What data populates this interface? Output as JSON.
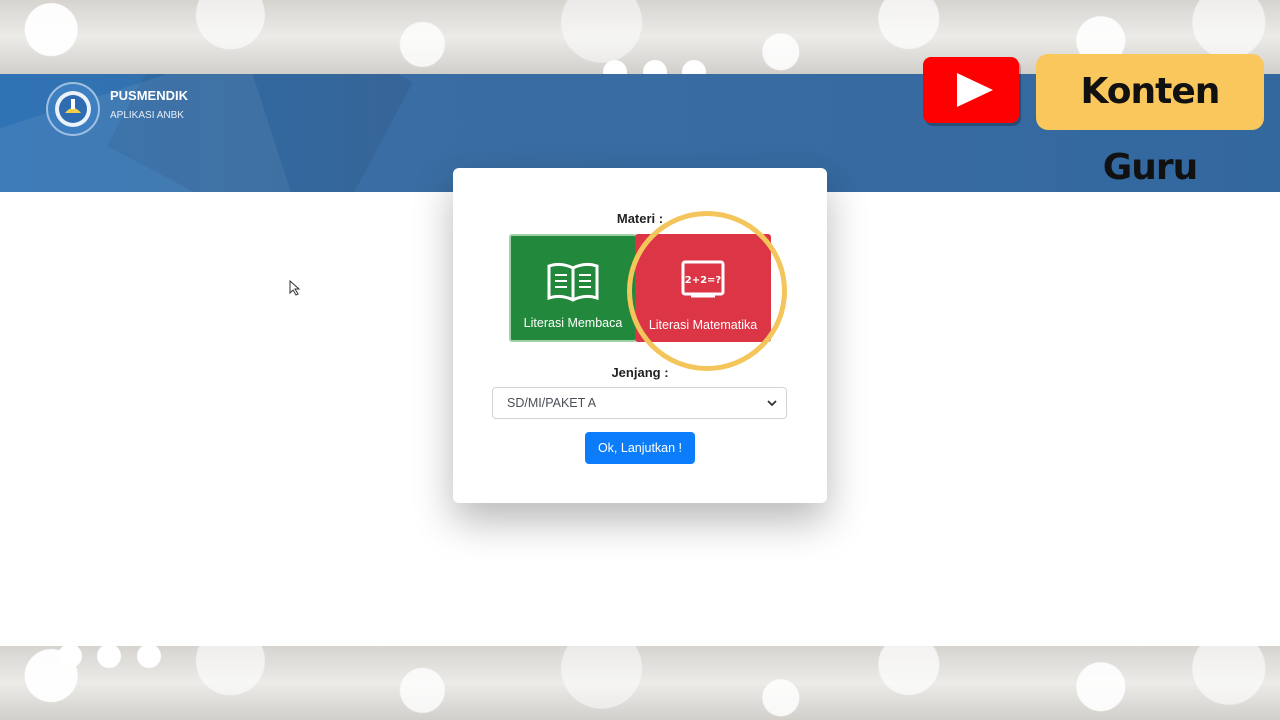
{
  "header": {
    "brand_title": "PUSMENDIK",
    "brand_subtitle": "APLIKASI ANBK",
    "bg_color": "#33689f"
  },
  "card": {
    "materi_label": "Materi :",
    "tiles": [
      {
        "label": "Literasi Membaca",
        "icon": "book-icon",
        "color": "#22883c"
      },
      {
        "label": "Literasi Matematika",
        "icon": "math-board-icon",
        "color": "#dc3545",
        "board_text": "2+2=?"
      }
    ],
    "jenjang_label": "Jenjang :",
    "jenjang_selected": "SD/MI/PAKET A",
    "submit_label": "Ok, Lanjutkan !",
    "submit_color": "#0b7dfa"
  },
  "overlay": {
    "badge_text": "Konten Guru",
    "badge_color": "#f9c75c",
    "youtube_color": "#ff0000",
    "highlight_color": "#f3c55a"
  }
}
